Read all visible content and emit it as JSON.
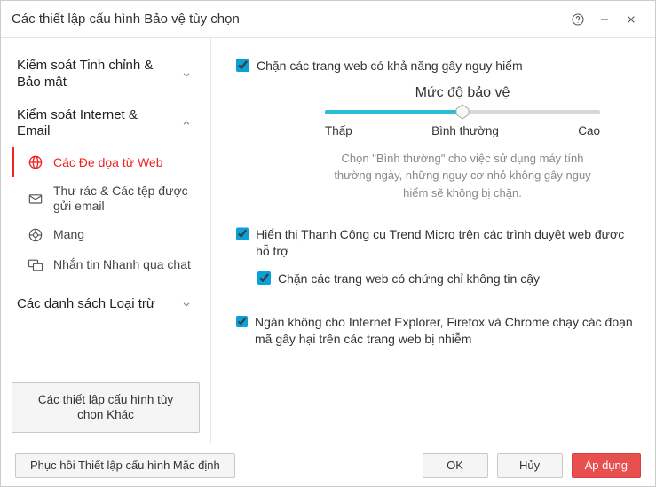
{
  "window": {
    "title": "Các thiết lập cấu hình Bảo vệ tùy chọn"
  },
  "sidebar": {
    "sections": [
      {
        "label": "Kiểm soát Tinh chỉnh & Bảo mật",
        "expanded": false
      },
      {
        "label": "Kiểm soát Internet & Email",
        "expanded": true,
        "items": [
          {
            "label": "Các Đe dọa từ Web",
            "active": true,
            "icon": "globe-shield"
          },
          {
            "label": "Thư rác & Các tệp được gửi email",
            "active": false,
            "icon": "mail"
          },
          {
            "label": "Mạng",
            "active": false,
            "icon": "network"
          },
          {
            "label": "Nhắn tin Nhanh qua chat",
            "active": false,
            "icon": "chat"
          }
        ]
      },
      {
        "label": "Các danh sách Loại trừ",
        "expanded": false
      }
    ],
    "other_button": "Các thiết lập cấu hình tùy chọn Khác"
  },
  "main": {
    "block_dangerous": {
      "checked": true,
      "label": "Chặn các trang web có khả năng gây nguy hiểm"
    },
    "slider": {
      "title": "Mức độ bảo vệ",
      "low": "Thấp",
      "mid": "Bình thường",
      "high": "Cao",
      "desc": "Chọn \"Bình thường\" cho việc sử dụng máy tính thường ngày, những nguy cơ nhỏ không gây nguy hiểm sẽ không bị chặn.",
      "position_pct": 50
    },
    "toolbar": {
      "checked": true,
      "label": "Hiển thị Thanh Công cụ Trend Micro trên các trình duyệt web được hỗ trợ"
    },
    "cert": {
      "checked": true,
      "label": "Chặn các trang web có chứng chỉ không tin cậy"
    },
    "script": {
      "checked": true,
      "label": "Ngăn không cho Internet Explorer, Firefox và Chrome chạy các đoạn mã gây hại trên các trang web bị nhiễm"
    }
  },
  "footer": {
    "restore": "Phục hồi Thiết lập cấu hình Mặc định",
    "ok": "OK",
    "cancel": "Hủy",
    "apply": "Áp dụng"
  }
}
